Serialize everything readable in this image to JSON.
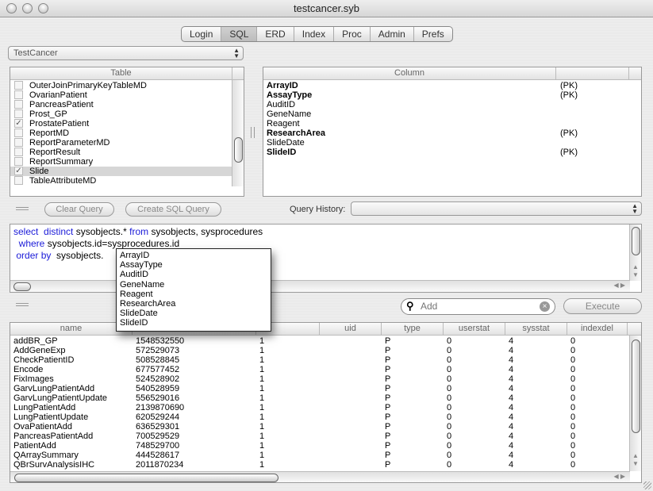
{
  "window": {
    "title": "testcancer.syb"
  },
  "tabs": [
    {
      "label": "Login"
    },
    {
      "label": "SQL",
      "selected": true
    },
    {
      "label": "ERD"
    },
    {
      "label": "Index"
    },
    {
      "label": "Proc"
    },
    {
      "label": "Admin"
    },
    {
      "label": "Prefs"
    }
  ],
  "database_select": {
    "value": "TestCancer"
  },
  "table_panel": {
    "header": "Table",
    "items": [
      {
        "label": "OuterJoinPrimaryKeyTableMD",
        "checked": false
      },
      {
        "label": "OvarianPatient",
        "checked": false
      },
      {
        "label": "PancreasPatient",
        "checked": false
      },
      {
        "label": "Prost_GP",
        "checked": false
      },
      {
        "label": "ProstatePatient",
        "checked": true
      },
      {
        "label": "ReportMD",
        "checked": false
      },
      {
        "label": "ReportParameterMD",
        "checked": false
      },
      {
        "label": "ReportResult",
        "checked": false
      },
      {
        "label": "ReportSummary",
        "checked": false
      },
      {
        "label": "Slide",
        "checked": true,
        "selected": true
      },
      {
        "label": "TableAttributeMD",
        "checked": false
      }
    ]
  },
  "column_panel": {
    "header": "Column",
    "items": [
      {
        "name": "ArrayID",
        "bold": true,
        "key": "(PK)"
      },
      {
        "name": "AssayType",
        "bold": true,
        "key": "(PK)"
      },
      {
        "name": "AuditID",
        "bold": false,
        "key": ""
      },
      {
        "name": "GeneName",
        "bold": false,
        "key": ""
      },
      {
        "name": "Reagent",
        "bold": false,
        "key": ""
      },
      {
        "name": "ResearchArea",
        "bold": true,
        "key": "(PK)"
      },
      {
        "name": "SlideDate",
        "bold": false,
        "key": ""
      },
      {
        "name": "SlideID",
        "bold": true,
        "key": "(PK)"
      }
    ]
  },
  "buttons": {
    "clear_query": "Clear Query",
    "create_sql": "Create SQL Query",
    "execute": "Execute"
  },
  "query_history": {
    "label": "Query History:",
    "value": ""
  },
  "sql": {
    "line1": {
      "kw1": "select",
      "kw2": "distinct",
      "t1": "sysobjects.*",
      "kw3": "from",
      "t2": "sysobjects, sysprocedures"
    },
    "line2": {
      "kw1": "where",
      "t1": "sysobjects.id=sysprocedures.id"
    },
    "line3": {
      "kw1": "order by",
      "t1": "sysobjects."
    }
  },
  "autocomplete": [
    "ArrayID",
    "AssayType",
    "AuditID",
    "GeneName",
    "Reagent",
    "ResearchArea",
    "SlideDate",
    "SlideID"
  ],
  "search": {
    "placeholder": "Add",
    "value": ""
  },
  "results": {
    "columns": [
      "name",
      "",
      "",
      "uid",
      "type",
      "userstat",
      "sysstat",
      "indexdel"
    ],
    "rows": [
      [
        "addBR_GP",
        "1548532550",
        "1",
        "",
        "P",
        "0",
        "4",
        "0"
      ],
      [
        "AddGeneExp",
        "572529073",
        "1",
        "",
        "P",
        "0",
        "4",
        "0"
      ],
      [
        "CheckPatientID",
        "508528845",
        "1",
        "",
        "P",
        "0",
        "4",
        "0"
      ],
      [
        "Encode",
        "677577452",
        "1",
        "",
        "P",
        "0",
        "4",
        "0"
      ],
      [
        "FixImages",
        "524528902",
        "1",
        "",
        "P",
        "0",
        "4",
        "0"
      ],
      [
        "GarvLungPatientAdd",
        "540528959",
        "1",
        "",
        "P",
        "0",
        "4",
        "0"
      ],
      [
        "GarvLungPatientUpdate",
        "556529016",
        "1",
        "",
        "P",
        "0",
        "4",
        "0"
      ],
      [
        "LungPatientAdd",
        "2139870690",
        "1",
        "",
        "P",
        "0",
        "4",
        "0"
      ],
      [
        "LungPatientUpdate",
        "620529244",
        "1",
        "",
        "P",
        "0",
        "4",
        "0"
      ],
      [
        "OvaPatientAdd",
        "636529301",
        "1",
        "",
        "P",
        "0",
        "4",
        "0"
      ],
      [
        "PancreasPatientAdd",
        "700529529",
        "1",
        "",
        "P",
        "0",
        "4",
        "0"
      ],
      [
        "PatientAdd",
        "748529700",
        "1",
        "",
        "P",
        "0",
        "4",
        "0"
      ],
      [
        "QArraySummary",
        "444528617",
        "1",
        "",
        "P",
        "0",
        "4",
        "0"
      ],
      [
        "QBrSurvAnalysisIHC",
        "2011870234",
        "1",
        "",
        "P",
        "0",
        "4",
        "0"
      ]
    ]
  }
}
